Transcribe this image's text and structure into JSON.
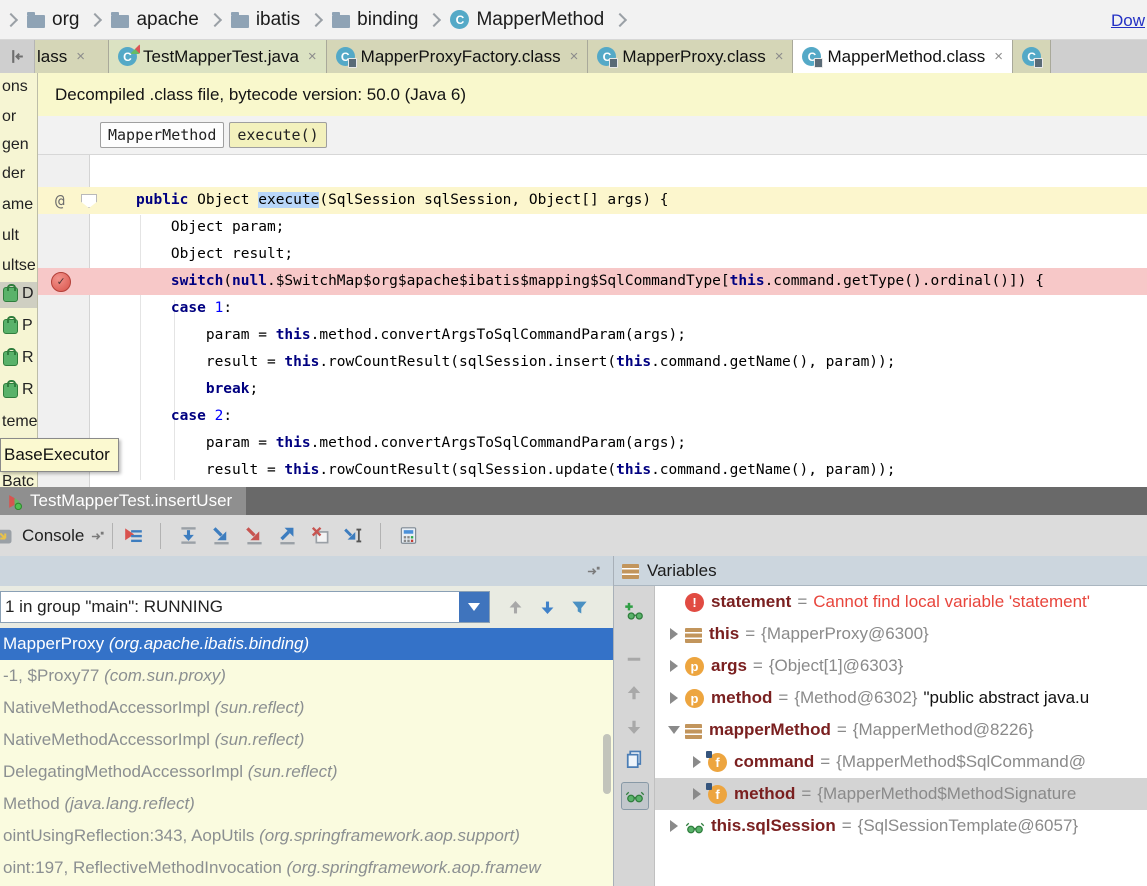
{
  "colors": {
    "accent_blue": "#3f74bd",
    "selection_blue": "#3472c8",
    "error_red": "#e8453c",
    "banner_bg": "#f9f8cc",
    "breakpoint_line_bg": "#f7c8c8",
    "current_line_bg": "#fcf6cd",
    "keyword_color": "#000080"
  },
  "breadcrumb": {
    "items": [
      {
        "kind": "folder",
        "label": "org"
      },
      {
        "kind": "folder",
        "label": "apache"
      },
      {
        "kind": "folder",
        "label": "ibatis"
      },
      {
        "kind": "folder",
        "label": "binding"
      },
      {
        "kind": "class",
        "label": "MapperMethod"
      }
    ]
  },
  "tab_bar": {
    "tabs": [
      {
        "label": "lass",
        "icon": "none",
        "close": "×",
        "state": "partial"
      },
      {
        "label": "TestMapperTest.java",
        "icon": "class-run",
        "close": "×",
        "state": "green"
      },
      {
        "label": "MapperProxyFactory.class",
        "icon": "class-lock",
        "close": "×",
        "state": "normal"
      },
      {
        "label": "MapperProxy.class",
        "icon": "class-lock",
        "close": "×",
        "state": "normal"
      },
      {
        "label": "MapperMethod.class",
        "icon": "class-lock",
        "close": "×",
        "state": "active"
      },
      {
        "label": "",
        "icon": "class-lock",
        "close": "",
        "state": "partial-right"
      }
    ]
  },
  "banner": {
    "text": "Decompiled .class file, bytecode version: 50.0 (Java 6)",
    "link_text": "Dow"
  },
  "chips": [
    {
      "label": "MapperMethod",
      "highlight": false
    },
    {
      "label": "execute()",
      "highlight": true
    }
  ],
  "side_strip": {
    "plain_items": [
      "ons",
      "or",
      "gen",
      "der",
      "ame",
      "ult",
      "ultse"
    ],
    "locked_items": [
      "D",
      "P",
      "R",
      "R"
    ],
    "tail_item": "teme",
    "tooltip": "BaseExecutor",
    "bottom_partial": "Batc"
  },
  "editor": {
    "lines": [
      {
        "bg": "current",
        "gutter": "at",
        "segments": [
          {
            "t": "public",
            "c": "k"
          },
          {
            "t": " Object ",
            "c": ""
          },
          {
            "t": "execute",
            "c": "sel"
          },
          {
            "t": "(SqlSession sqlSession, Object[] args) {",
            "c": ""
          }
        ]
      },
      {
        "bg": "",
        "gutter": "",
        "segments": [
          {
            "t": "    Object param;",
            "c": ""
          }
        ]
      },
      {
        "bg": "",
        "gutter": "",
        "segments": [
          {
            "t": "    Object result;",
            "c": ""
          }
        ]
      },
      {
        "bg": "bp",
        "gutter": "bp",
        "segments": [
          {
            "t": "    ",
            "c": ""
          },
          {
            "t": "switch",
            "c": "k"
          },
          {
            "t": "(",
            "c": ""
          },
          {
            "t": "null",
            "c": "k"
          },
          {
            "t": ".$SwitchMap$org$apache$ibatis$mapping$SqlCommandType[",
            "c": ""
          },
          {
            "t": "this",
            "c": "k"
          },
          {
            "t": ".command.getType().ordinal()]) {",
            "c": ""
          }
        ]
      },
      {
        "bg": "",
        "gutter": "",
        "segments": [
          {
            "t": "    ",
            "c": ""
          },
          {
            "t": "case",
            "c": "k"
          },
          {
            "t": " ",
            "c": ""
          },
          {
            "t": "1",
            "c": "n"
          },
          {
            "t": ":",
            "c": ""
          }
        ]
      },
      {
        "bg": "",
        "gutter": "",
        "segments": [
          {
            "t": "        param = ",
            "c": ""
          },
          {
            "t": "this",
            "c": "k"
          },
          {
            "t": ".method.convertArgsToSqlCommandParam(args);",
            "c": ""
          }
        ]
      },
      {
        "bg": "",
        "gutter": "",
        "segments": [
          {
            "t": "        result = ",
            "c": ""
          },
          {
            "t": "this",
            "c": "k"
          },
          {
            "t": ".rowCountResult(sqlSession.insert(",
            "c": ""
          },
          {
            "t": "this",
            "c": "k"
          },
          {
            "t": ".command.getName(), param));",
            "c": ""
          }
        ]
      },
      {
        "bg": "",
        "gutter": "",
        "segments": [
          {
            "t": "        ",
            "c": ""
          },
          {
            "t": "break",
            "c": "k"
          },
          {
            "t": ";",
            "c": ""
          }
        ]
      },
      {
        "bg": "",
        "gutter": "",
        "segments": [
          {
            "t": "    ",
            "c": ""
          },
          {
            "t": "case",
            "c": "k"
          },
          {
            "t": " ",
            "c": ""
          },
          {
            "t": "2",
            "c": "n"
          },
          {
            "t": ":",
            "c": ""
          }
        ]
      },
      {
        "bg": "",
        "gutter": "",
        "segments": [
          {
            "t": "        param = ",
            "c": ""
          },
          {
            "t": "this",
            "c": "k"
          },
          {
            "t": ".method.convertArgsToSqlCommandParam(args);",
            "c": ""
          }
        ]
      },
      {
        "bg": "",
        "gutter": "",
        "segments": [
          {
            "t": "        result = ",
            "c": ""
          },
          {
            "t": "this",
            "c": "k"
          },
          {
            "t": ".rowCountResult(sqlSession.update(",
            "c": ""
          },
          {
            "t": "this",
            "c": "k"
          },
          {
            "t": ".command.getName(), param));",
            "c": ""
          }
        ]
      }
    ]
  },
  "debug_tab": {
    "label": "TestMapperTest.insertUser"
  },
  "console_bar": {
    "label": "Console",
    "icons": [
      "show-execution-point",
      "step-over",
      "step-into",
      "force-step-into",
      "step-out",
      "drop-frame",
      "run-to-cursor",
      "evaluate-expression"
    ]
  },
  "frames": {
    "thread_selector": "1 in group \"main\": RUNNING",
    "rows": [
      {
        "method": "MapperProxy ",
        "pkg": "(org.apache.ibatis.binding)",
        "selected": true
      },
      {
        "method": "-1, $Proxy77 ",
        "pkg": "(com.sun.proxy)",
        "selected": false
      },
      {
        "method": "NativeMethodAccessorImpl ",
        "pkg": "(sun.reflect)",
        "selected": false
      },
      {
        "method": "NativeMethodAccessorImpl ",
        "pkg": "(sun.reflect)",
        "selected": false
      },
      {
        "method": "DelegatingMethodAccessorImpl ",
        "pkg": "(sun.reflect)",
        "selected": false
      },
      {
        "method": "Method ",
        "pkg": "(java.lang.reflect)",
        "selected": false
      },
      {
        "method": "ointUsingReflection:343, AopUtils ",
        "pkg": "(org.springframework.aop.support)",
        "selected": false
      },
      {
        "method": "oint:197, ReflectiveMethodInvocation ",
        "pkg": "(org.springframework.aop.framew",
        "selected": false
      }
    ]
  },
  "variables": {
    "title": "Variables",
    "toolbar_icons": [
      "add-watch",
      "remove-watch",
      "move-up",
      "move-down",
      "duplicate",
      "show-watches"
    ],
    "rows": [
      {
        "icon": "error",
        "name": "statement",
        "eq": "=",
        "value": "Cannot find local variable 'statement'",
        "value_style": "error",
        "extra": "",
        "indent": 0,
        "expander": "none",
        "selected": false
      },
      {
        "icon": "value",
        "name": "this",
        "eq": "=",
        "value": "{MapperProxy@6300}",
        "value_style": "",
        "extra": "",
        "indent": 0,
        "expander": "collapsed",
        "selected": false
      },
      {
        "icon": "param",
        "name": "args",
        "eq": "=",
        "value": "{Object[1]@6303}",
        "value_style": "",
        "extra": "",
        "indent": 0,
        "expander": "collapsed",
        "selected": false
      },
      {
        "icon": "param",
        "name": "method",
        "eq": "=",
        "value": "{Method@6302}",
        "value_style": "",
        "extra": "\"public abstract java.u",
        "indent": 0,
        "expander": "collapsed",
        "selected": false
      },
      {
        "icon": "value",
        "name": "mapperMethod",
        "eq": "=",
        "value": "{MapperMethod@8226}",
        "value_style": "",
        "extra": "",
        "indent": 0,
        "expander": "expanded",
        "selected": false
      },
      {
        "icon": "field",
        "name": "command",
        "eq": "=",
        "value": "{MapperMethod$SqlCommand@",
        "value_style": "",
        "extra": "",
        "indent": 1,
        "expander": "collapsed",
        "selected": false
      },
      {
        "icon": "field",
        "name": "method",
        "eq": "=",
        "value": "{MapperMethod$MethodSignature",
        "value_style": "",
        "extra": "",
        "indent": 1,
        "expander": "collapsed",
        "selected": true
      },
      {
        "icon": "watch",
        "name": "this.sqlSession",
        "eq": "=",
        "value": "{SqlSessionTemplate@6057}",
        "value_style": "",
        "extra": "",
        "indent": 0,
        "expander": "collapsed",
        "selected": false
      }
    ]
  }
}
